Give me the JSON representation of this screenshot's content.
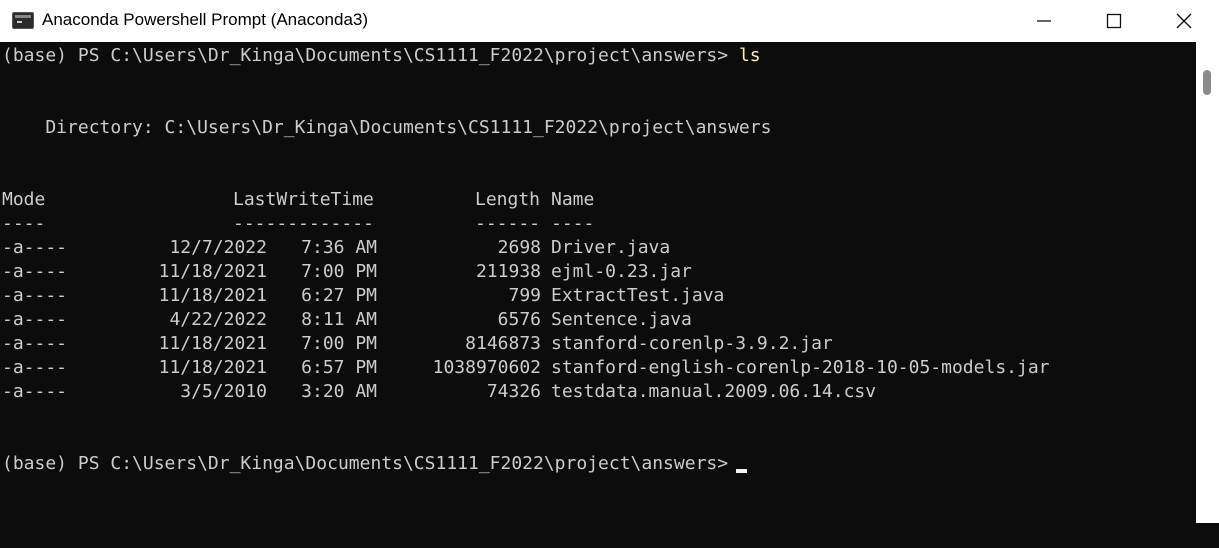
{
  "window": {
    "title": "Anaconda Powershell Prompt (Anaconda3)",
    "icon": "terminal-icon",
    "controls": {
      "minimize": "minimize-icon",
      "maximize": "maximize-icon",
      "close": "close-icon"
    }
  },
  "terminal": {
    "prompt1": "(base) PS C:\\Users\\Dr_Kinga\\Documents\\CS1111_F2022\\project\\answers>",
    "command1": "ls",
    "directory_line": "    Directory: C:\\Users\\Dr_Kinga\\Documents\\CS1111_F2022\\project\\answers",
    "headers": {
      "mode": "Mode",
      "lastwritetime": "LastWriteTime",
      "length": "Length",
      "name": "Name"
    },
    "separators": {
      "mode": "----",
      "lastwritetime": "-------------",
      "length": "------",
      "name": "----"
    },
    "rows": [
      {
        "mode": "-a----",
        "date": "12/7/2022",
        "time": "7:36 AM",
        "length": "2698",
        "name": "Driver.java"
      },
      {
        "mode": "-a----",
        "date": "11/18/2021",
        "time": "7:00 PM",
        "length": "211938",
        "name": "ejml-0.23.jar"
      },
      {
        "mode": "-a----",
        "date": "11/18/2021",
        "time": "6:27 PM",
        "length": "799",
        "name": "ExtractTest.java"
      },
      {
        "mode": "-a----",
        "date": "4/22/2022",
        "time": "8:11 AM",
        "length": "6576",
        "name": "Sentence.java"
      },
      {
        "mode": "-a----",
        "date": "11/18/2021",
        "time": "7:00 PM",
        "length": "8146873",
        "name": "stanford-corenlp-3.9.2.jar"
      },
      {
        "mode": "-a----",
        "date": "11/18/2021",
        "time": "6:57 PM",
        "length": "1038970602",
        "name": "stanford-english-corenlp-2018-10-05-models.jar"
      },
      {
        "mode": "-a----",
        "date": "3/5/2010",
        "time": "3:20 AM",
        "length": "74326",
        "name": "testdata.manual.2009.06.14.csv"
      }
    ],
    "prompt2": "(base) PS C:\\Users\\Dr_Kinga\\Documents\\CS1111_F2022\\project\\answers>"
  },
  "colors": {
    "background": "#0c0c0c",
    "text": "#cccccc",
    "command": "#f9f1a5",
    "titlebar": "#ffffff"
  }
}
